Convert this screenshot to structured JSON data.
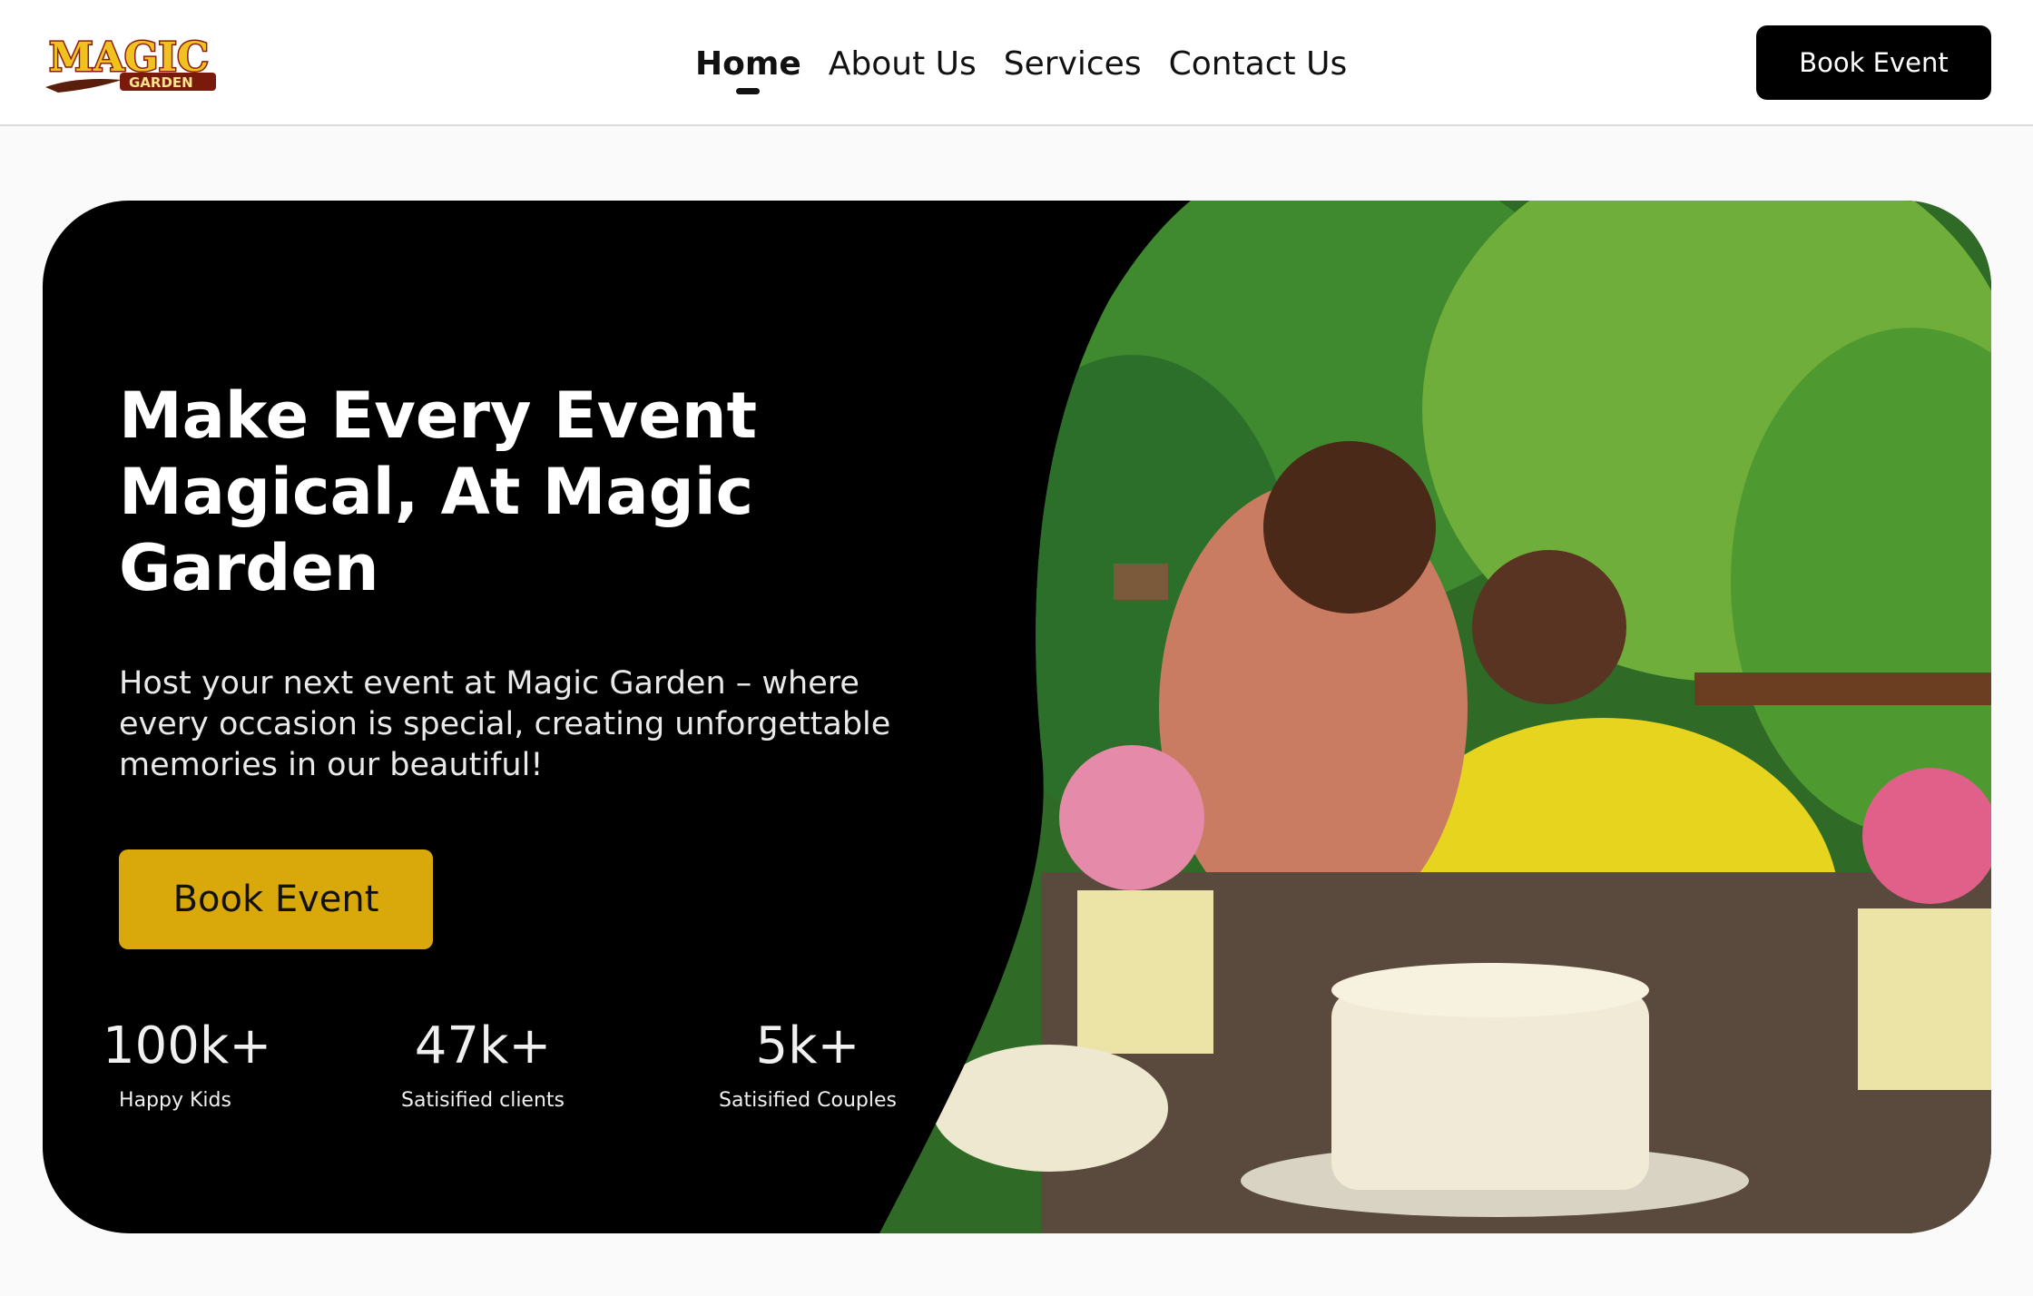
{
  "header": {
    "logo": {
      "text_main": "MAGIC",
      "text_sub": "GARDEN"
    },
    "nav": [
      {
        "label": "Home",
        "active": true
      },
      {
        "label": "About Us",
        "active": false
      },
      {
        "label": "Services",
        "active": false
      },
      {
        "label": "Contact Us",
        "active": false
      }
    ],
    "book_button_label": "Book Event"
  },
  "hero": {
    "title": "Make Every Event Magical, At Magic Garden",
    "description": "Host your next event at Magic Garden – where every occasion is special, creating unforgettable memories in our beautiful!",
    "book_button_label": "Book Event",
    "stats": [
      {
        "value": "100k+",
        "label": "Happy Kids"
      },
      {
        "value": "47k+",
        "label": "Satisified clients"
      },
      {
        "value": "5k+",
        "label": "Satisified Couples"
      }
    ],
    "image_icon": "photo-icon"
  },
  "colors": {
    "accent": "#d9a80b",
    "header_button": "#000000",
    "hero_background": "#000000",
    "page_background": "#fafafa"
  }
}
